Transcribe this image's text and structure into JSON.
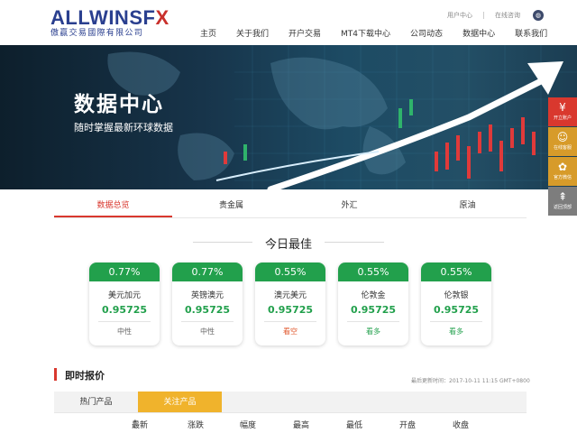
{
  "brand": {
    "logo_word_a": "ALLWINSF",
    "logo_word_x": "X",
    "logo_sub": "傲贏交易國際有限公司"
  },
  "utility": {
    "user_center": "用户中心",
    "online_consult": "在线咨询",
    "lang_icon": "globe-icon"
  },
  "nav": {
    "items": [
      "主页",
      "关于我们",
      "开户交易",
      "MT4下载中心",
      "公司动态",
      "数据中心",
      "联系我们"
    ]
  },
  "banner": {
    "title": "数据中心",
    "subtitle": "随时掌握最新环球数据"
  },
  "float_buttons": [
    {
      "label": "开立账户",
      "icon": "¥"
    },
    {
      "label": "在线客服",
      "icon": "☺"
    },
    {
      "label": "官方微信",
      "icon": "✿"
    },
    {
      "label": "返回顶部",
      "icon": "⇞"
    }
  ],
  "tabs": [
    "数据总览",
    "贵金属",
    "外汇",
    "原油"
  ],
  "best": {
    "title": "今日最佳",
    "cards": [
      {
        "pct": "0.77%",
        "name": "美元加元",
        "price": "0.95725",
        "trend": "中性"
      },
      {
        "pct": "0.77%",
        "name": "英镑澳元",
        "price": "0.95725",
        "trend": "中性"
      },
      {
        "pct": "0.55%",
        "name": "澳元美元",
        "price": "0.95725",
        "trend": "看空"
      },
      {
        "pct": "0.55%",
        "name": "伦敦金",
        "price": "0.95725",
        "trend": "看多"
      },
      {
        "pct": "0.55%",
        "name": "伦敦银",
        "price": "0.95725",
        "trend": "看多"
      }
    ]
  },
  "quotes": {
    "title": "即时报价",
    "last_update": "最后更新时间：2017-10-11 11:15 GMT+0800",
    "tabs": [
      "热门产品",
      "关注产品"
    ],
    "columns": [
      "最新",
      "涨跌",
      "幅度",
      "最高",
      "最低",
      "开盘",
      "收盘"
    ]
  },
  "colors": {
    "accent_red": "#d9382e",
    "up_green": "#22a04c",
    "gold": "#f0b32c",
    "brand_blue": "#2a3f8f"
  }
}
